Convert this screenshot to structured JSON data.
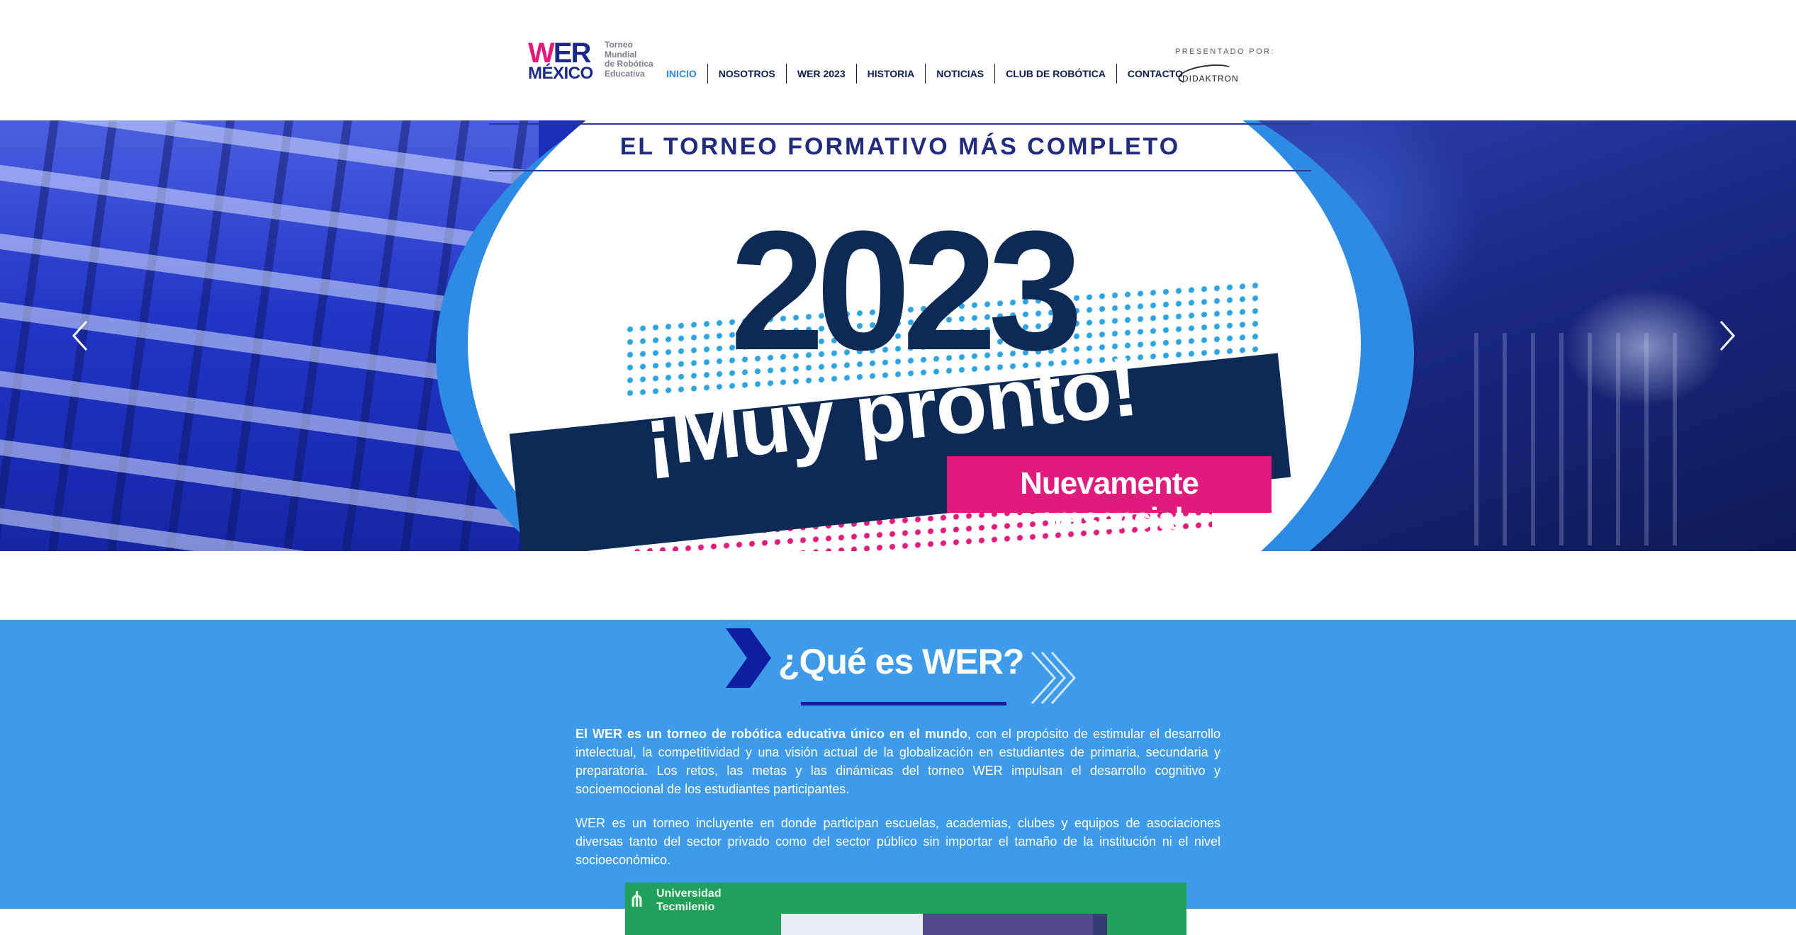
{
  "header": {
    "logo": {
      "wer_w": "W",
      "wer_er": "ER",
      "mexico": "MÉXICO",
      "subtitle_lines": [
        "Torneo",
        "Mundial",
        "de Robótica",
        "Educativa"
      ]
    },
    "nav": [
      {
        "label": "INICIO",
        "active": true
      },
      {
        "label": "NOSOTROS"
      },
      {
        "label": "WER 2023"
      },
      {
        "label": "HISTORIA"
      },
      {
        "label": "NOTICIAS"
      },
      {
        "label": "CLUB DE ROBÓTICA"
      },
      {
        "label": "CONTACTO"
      }
    ],
    "presented_by": "PRESENTADO POR:",
    "sponsor": "DIDAKTRON"
  },
  "hero": {
    "tagline": "EL TORNEO FORMATIVO MÁS COMPLETO",
    "year": "2023",
    "headline": "¡Muy pronto!",
    "badge": "Nuevamente presencial",
    "prev_icon": "chevron-left-icon",
    "next_icon": "chevron-right-icon"
  },
  "about": {
    "title": "¿Qué es WER?",
    "p1_bold": "El WER es un torneo de robótica educativa único en el mundo",
    "p1_rest": ", con el propósito de estimular el desarrollo intelectual, la competitividad y una visión actual de la globalización en estudiantes de primaria, secundaria y preparatoria. Los retos, las metas y las dinámicas del torneo WER impulsan el desarrollo cognitivo y socioemocional de los estudiantes participantes.",
    "p2": "WER es un torneo incluyente en donde participan escuelas, academias, clubes y equipos de asociaciones diversas tanto del sector privado como del sector público sin importar el tamaño de la institución ni el nivel socioeconómico."
  },
  "video": {
    "logo_line1": "Universidad",
    "logo_line2": "Tecmilenio"
  },
  "colors": {
    "nav_text": "#111a55",
    "nav_active": "#2f86e0",
    "hero_navy": "#0d2a56",
    "hero_pink": "#e01b7b",
    "about_bg": "#3d9be9",
    "about_accent": "#0f1ea0"
  }
}
